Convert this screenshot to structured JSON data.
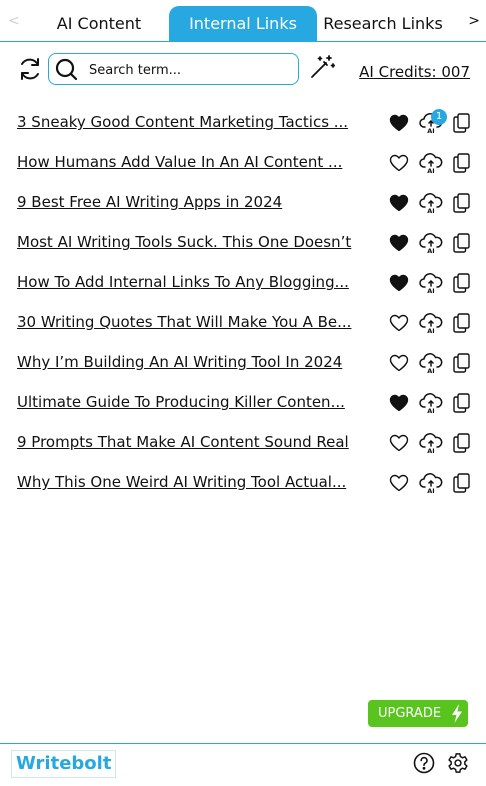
{
  "tabs": {
    "prev_arrow": "<",
    "next_arrow": ">",
    "items": [
      {
        "label": "AI Content"
      },
      {
        "label": "Internal Links"
      },
      {
        "label": "Research Links"
      }
    ],
    "active": "Internal Links"
  },
  "toolbar": {
    "search_placeholder": "Search term...",
    "credits": "AI Credits: 007"
  },
  "links": [
    {
      "title": "3 Sneaky Good Content Marketing Tactics ...",
      "favorite": true,
      "badge": "1"
    },
    {
      "title": "How Humans Add Value In An AI Content ...",
      "favorite": false
    },
    {
      "title": "9 Best Free AI Writing Apps in 2024",
      "favorite": true
    },
    {
      "title": "Most AI Writing Tools Suck. This One Doesn’t",
      "favorite": true
    },
    {
      "title": "How To Add Internal Links To Any Blogging...",
      "favorite": true
    },
    {
      "title": "30 Writing Quotes That Will Make You A Be...",
      "favorite": false
    },
    {
      "title": "Why I’m Building An AI Writing Tool In 2024",
      "favorite": false
    },
    {
      "title": "Ultimate Guide To Producing Killer Conten...",
      "favorite": true
    },
    {
      "title": "9 Prompts That Make AI Content Sound Real",
      "favorite": false
    },
    {
      "title": "Why This One Weird AI Writing Tool Actual...",
      "favorite": false
    }
  ],
  "upgrade_label": "UPGRADE",
  "footer": {
    "logo": "Writebolt"
  },
  "colors": {
    "accent": "#27a8e0",
    "upgrade": "#5ac41e"
  },
  "icons": {
    "refresh": "refresh-icon",
    "search": "search-icon",
    "wand": "magic-wand-icon",
    "heart": "heart-icon",
    "cloud": "ai-cloud-upload-icon",
    "copy": "copy-icon",
    "bolt": "lightning-bolt-icon",
    "help": "help-icon",
    "settings": "gear-icon"
  }
}
